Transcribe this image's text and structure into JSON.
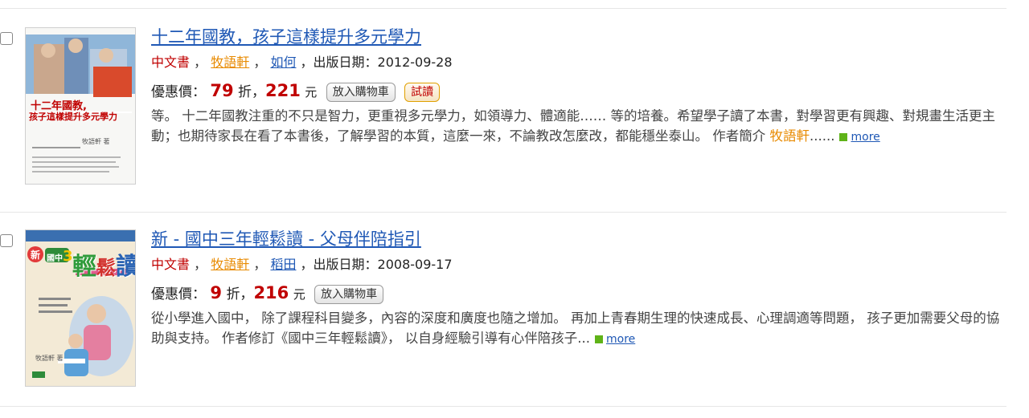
{
  "items": [
    {
      "title": "十二年國教，孩子這樣提升多元學力",
      "category": "中文書",
      "sep1": "，",
      "author": "牧語軒",
      "sep2": "，",
      "publisher": "如何",
      "date_text": "，出版日期：2012-09-28",
      "price_label": "優惠價：",
      "discount": "79",
      "discount_unit": "折，",
      "price": "221",
      "price_unit": "元",
      "cart_button": "放入購物車",
      "trial_button": "試讀",
      "description": "等。 十二年國教注重的不只是智力，更重視多元學力，如領導力、體適能…… 等的培養。希望學子讀了本書，對學習更有興趣、對規畫生活更主動；也期待家長在看了本書後，了解學習的本質，這麼一來，不論教改怎麼改，都能穩坐泰山。 作者簡介 ",
      "description_author": "牧語軒",
      "description_tail": "......",
      "more": "more",
      "cover": {
        "top_text": "十二年國教,",
        "bottom_text": "孩子這樣提升多元學力",
        "author_text": "牧語軒 著"
      }
    },
    {
      "title": "新 - 國中三年輕鬆讀 - 父母伴陪指引",
      "category": "中文書",
      "sep1": "，",
      "author": "牧語軒",
      "sep2": "，",
      "publisher": "稻田",
      "date_text": "，出版日期：2008-09-17",
      "price_label": "優惠價：",
      "discount": "9",
      "discount_unit": "折，",
      "price": "216",
      "price_unit": "元",
      "cart_button": "放入購物車",
      "description": "從小學進入國中， 除了課程科目變多，內容的深度和廣度也隨之增加。 再加上青春期生理的快速成長、心理調適等問題， 孩子更加需要父母的協助與支持。 作者修訂《國中三年輕鬆讀》， 以自身經驗引導有心伴陪孩子...",
      "more": "more",
      "cover": {
        "badge": "新",
        "grade_text": "國中",
        "grade_num": "3",
        "grade_unit": "年",
        "big_text_1": "輕",
        "big_text_2": "鬆",
        "big_text_3": "讀",
        "author_text": "牧語軒 著"
      }
    }
  ]
}
